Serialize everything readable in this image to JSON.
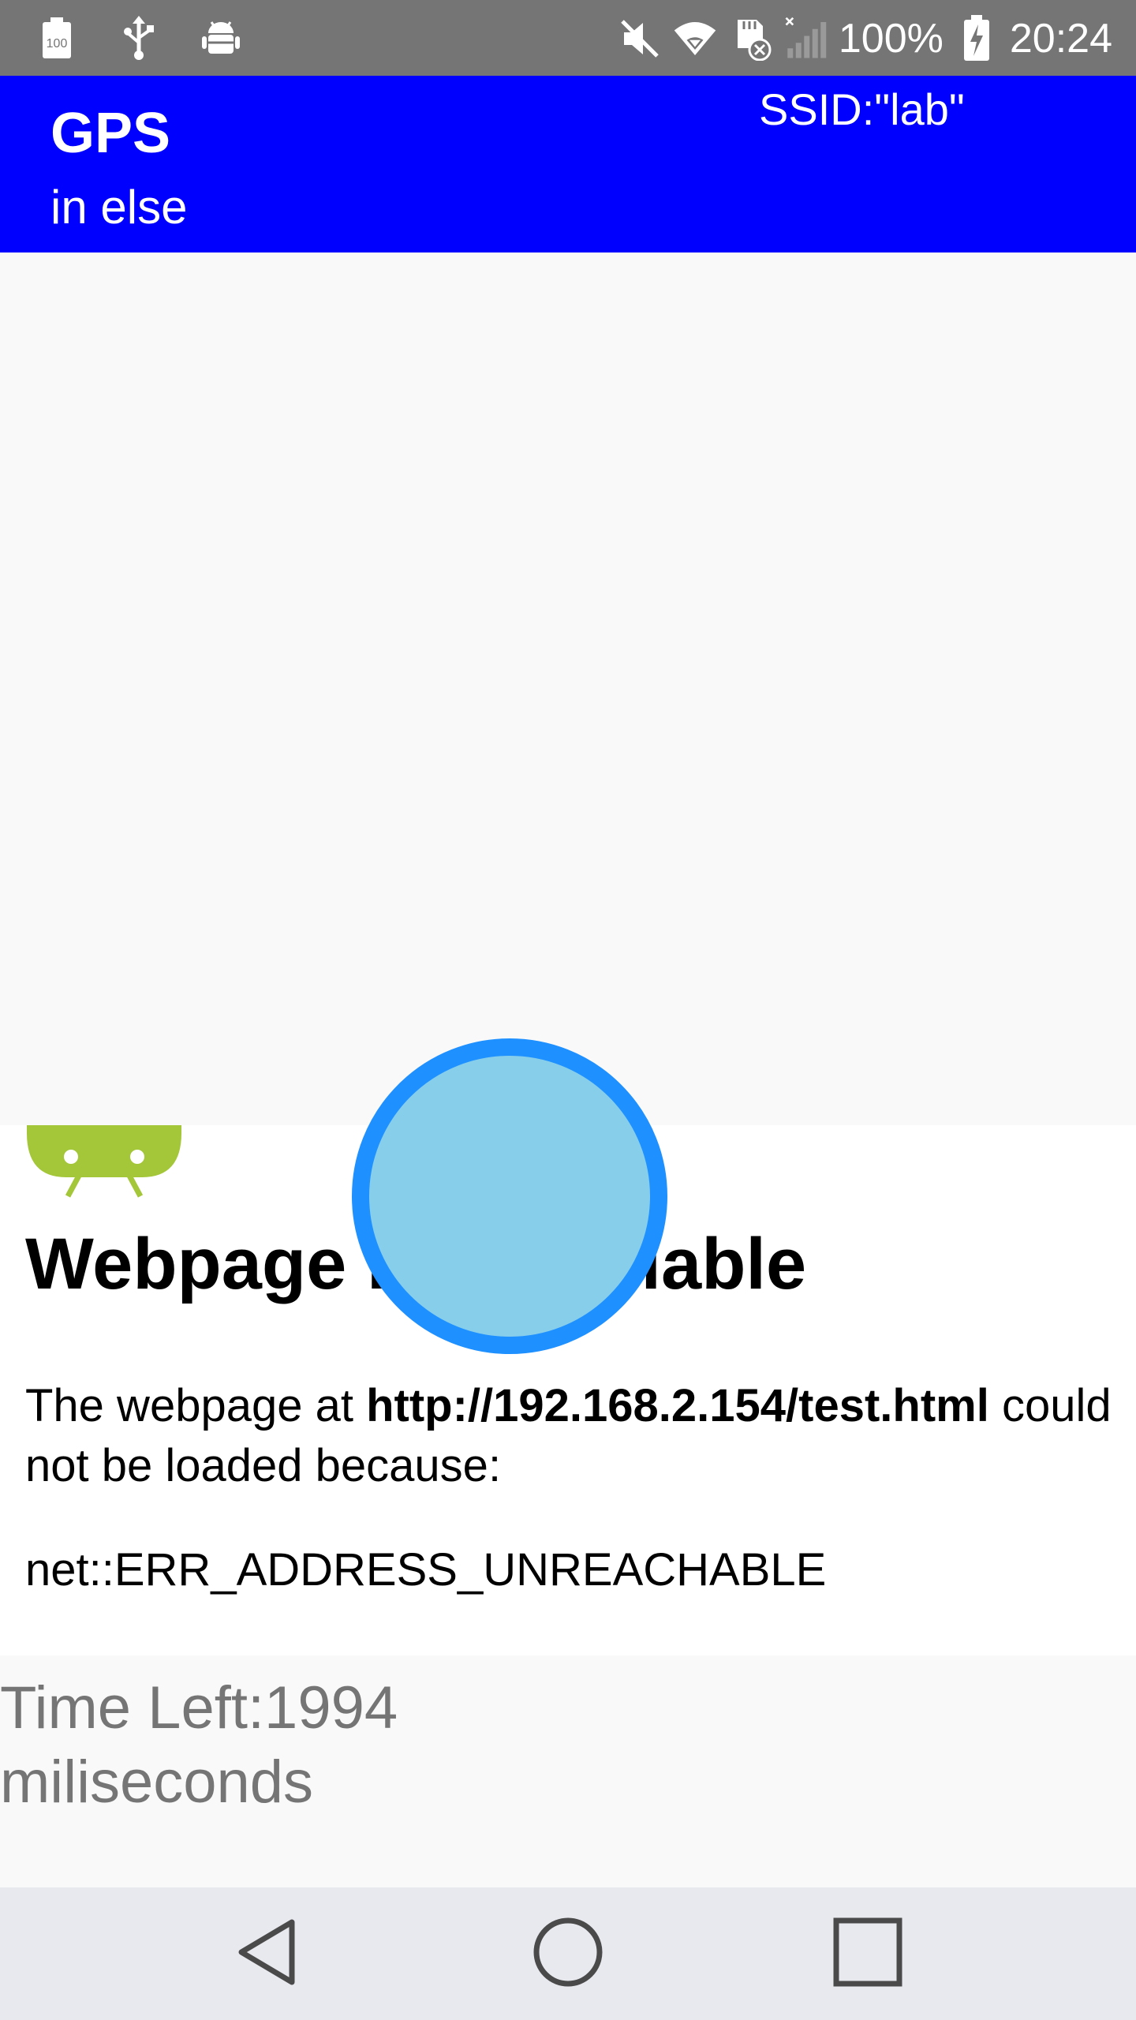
{
  "status_bar": {
    "battery_percent": "100%",
    "time": "20:24",
    "left_icons": [
      "battery-100-icon",
      "usb-icon",
      "android-debug-icon"
    ],
    "right_icons": [
      "mute-icon",
      "wifi-icon",
      "sd-card-error-icon",
      "no-signal-icon",
      "charging-battery-icon"
    ]
  },
  "app_bar": {
    "title": "GPS",
    "subtitle": "in else",
    "ssid": "SSID:\"lab\"",
    "color": "#0000ff"
  },
  "webview": {
    "heading": "Webpage not available",
    "body_prefix": "The webpage at ",
    "url": "http://192.168.2.154/test.html",
    "body_suffix": " could not be loaded because:",
    "error_code": "net::ERR_ADDRESS_UNREACHABLE"
  },
  "timer": {
    "line1": "Time Left:1994",
    "line2": "miliseconds"
  },
  "nav_bar": {
    "icons": [
      "back-icon",
      "home-icon",
      "recents-icon"
    ]
  },
  "colors": {
    "touch_fill": "#87ceeb",
    "touch_border": "#1e90ff",
    "status_bar": "#757575"
  }
}
